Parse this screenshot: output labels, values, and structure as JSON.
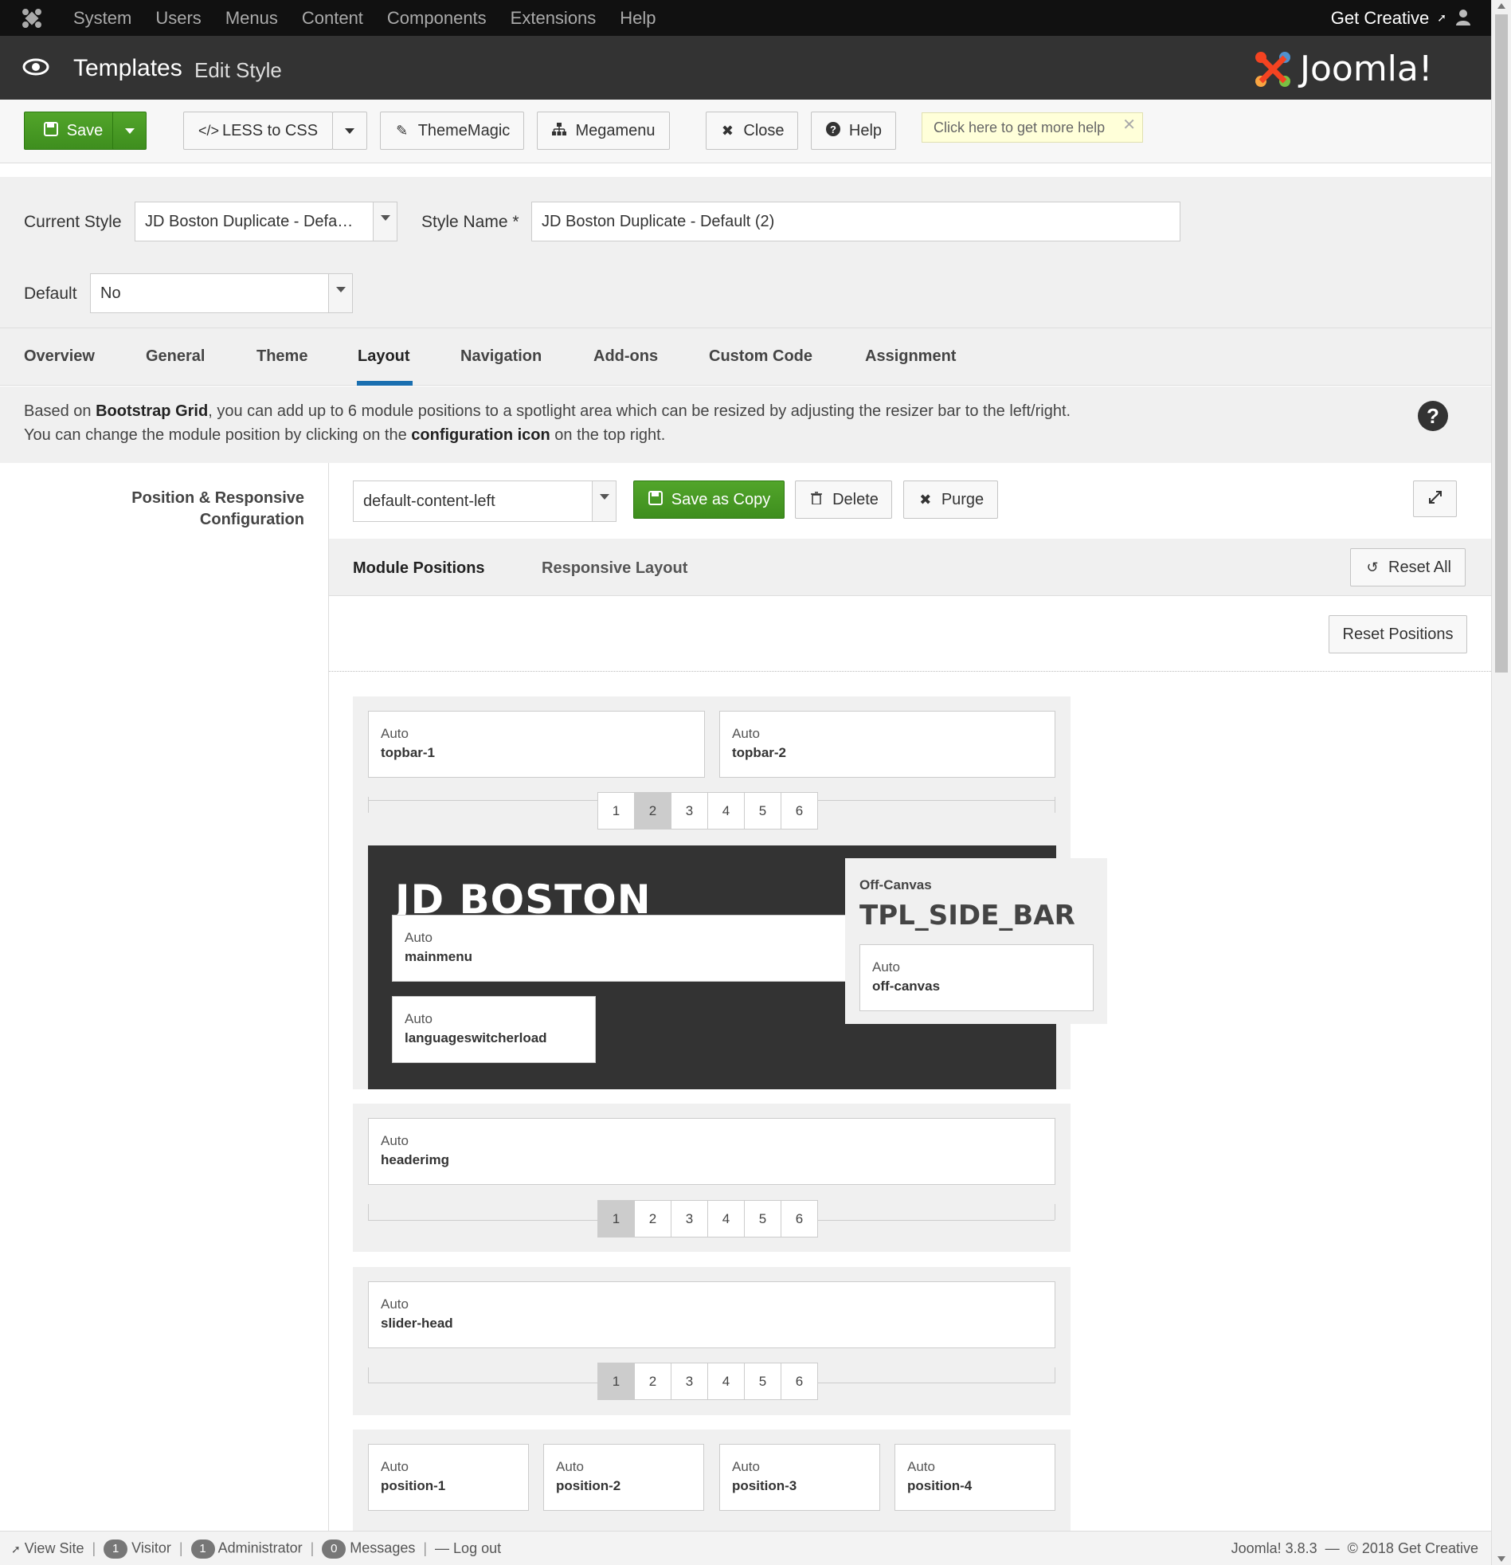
{
  "topnav": {
    "menu": [
      "System",
      "Users",
      "Menus",
      "Content",
      "Components",
      "Extensions",
      "Help"
    ],
    "site_link": "Get Creative"
  },
  "header": {
    "title": "Templates",
    "subtitle": "Edit Style",
    "logo_text": "Joomla!"
  },
  "toolbar": {
    "save": "Save",
    "less_to_css": "LESS to CSS",
    "thememagic": "ThemeMagic",
    "megamenu": "Megamenu",
    "close": "Close",
    "help": "Help",
    "help_tip": "Click here to get more help"
  },
  "form": {
    "current_style_label": "Current Style",
    "current_style_value": "JD Boston Duplicate - Defa…",
    "style_name_label": "Style Name *",
    "style_name_value": "JD Boston Duplicate - Default (2)",
    "default_label": "Default",
    "default_value": "No"
  },
  "tabs": [
    "Overview",
    "General",
    "Theme",
    "Layout",
    "Navigation",
    "Add-ons",
    "Custom Code",
    "Assignment"
  ],
  "active_tab": "Layout",
  "info": {
    "line1_a": "Based on ",
    "line1_b": "Bootstrap Grid",
    "line1_c": ", you can add up to 6 module positions to a spotlight area which can be resized by adjusting the resizer bar to the left/right.",
    "line2_a": "You can change the module position by clicking on the ",
    "line2_b": "configuration icon",
    "line2_c": " on the top right."
  },
  "position_config": {
    "label_line1": "Position & Responsive",
    "label_line2": "Configuration",
    "layout_select": "default-content-left",
    "save_as_copy": "Save as Copy",
    "delete": "Delete",
    "purge": "Purge"
  },
  "subtabs": {
    "module_positions": "Module Positions",
    "responsive_layout": "Responsive Layout",
    "reset_all": "Reset All",
    "reset_positions": "Reset Positions"
  },
  "layout": {
    "auto": "Auto",
    "topbar": [
      "topbar-1",
      "topbar-2"
    ],
    "mainmenu": "mainmenu",
    "languageswitcher": "languageswitcherload",
    "logo_text": "JD BOSTON",
    "offcanvas_label": "Off-Canvas",
    "offcanvas_title": "TPL_SIDE_BAR",
    "offcanvas_pos": "off-canvas",
    "headerimg": "headerimg",
    "slider_head": "slider-head",
    "positions": [
      "position-1",
      "position-2",
      "position-3",
      "position-4"
    ],
    "numbers": [
      "1",
      "2",
      "3",
      "4",
      "5",
      "6"
    ]
  },
  "status": {
    "view_site": "View Site",
    "visitor_count": "1",
    "visitor": "Visitor",
    "admin_count": "1",
    "admin": "Administrator",
    "messages_count": "0",
    "messages": "Messages",
    "logout": "Log out",
    "version": "Joomla! 3.8.3",
    "copyright": "© 2018 Get Creative"
  }
}
